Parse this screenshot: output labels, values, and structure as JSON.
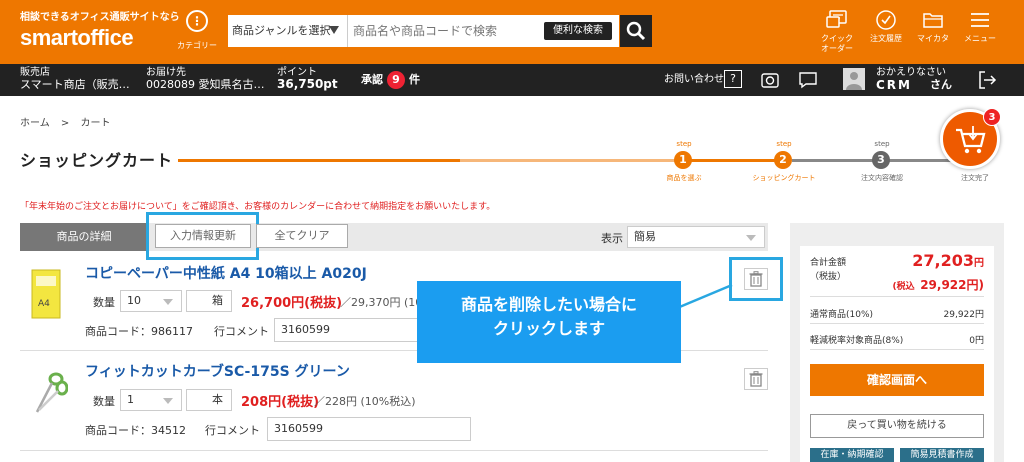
{
  "header": {
    "tagline": "相談できるオフィス通販サイトなら",
    "logo": "smartoffice",
    "category_label": "カテゴリー",
    "search": {
      "genre": "商品ジャンルを選択",
      "placeholder": "商品名や商品コードで検索",
      "advanced": "便利な検索"
    },
    "icons": [
      {
        "icon": "card-icon",
        "label_line1": "クイック",
        "label_line2": "オーダー"
      },
      {
        "icon": "history-icon",
        "label_line1": "注文履歴",
        "label_line2": ""
      },
      {
        "icon": "folder-icon",
        "label_line1": "マイカタ",
        "label_line2": ""
      },
      {
        "icon": "menu-icon",
        "label_line1": "メニュー",
        "label_line2": ""
      }
    ]
  },
  "infobar": {
    "store_label": "販売店",
    "store_value": "スマート商店（販売…",
    "ship_label": "お届け先",
    "ship_value": "0028089 愛知県名古…",
    "points_label": "ポイント",
    "points_value": "36,750pt",
    "approval_label": "承認",
    "approval_count": "9",
    "approval_suffix": "件",
    "contact": "お問い合わせ",
    "contact_icon": "?",
    "greeting": "おかえりなさい",
    "user_name": "CRM",
    "user_suffix": "さん"
  },
  "breadcrumb": {
    "home": "ホーム",
    "sep": ">",
    "current": "カート"
  },
  "page_title": "ショッピングカート",
  "steps": [
    {
      "word": "step",
      "num": "1",
      "label": "商品を選ぶ"
    },
    {
      "word": "step",
      "num": "2",
      "label": "ショッピングカート"
    },
    {
      "word": "step",
      "num": "3",
      "label": "注文内容確認"
    },
    {
      "word": "",
      "num": "",
      "label": "注文完了"
    }
  ],
  "cart_badge": "3",
  "notice": "「年末年始のご注文とお届けについて」をご確認頂き、お客様のカレンダーに合わせて納期指定をお願いいたします。",
  "toolbar": {
    "tab": "商品の詳細",
    "update": "入力情報更新",
    "clear": "全てクリア",
    "display_label": "表示",
    "display_value": "簡易"
  },
  "items": [
    {
      "name": "コピーペーパー中性紙 A4 10箱以上 A020J",
      "qty_label": "数量",
      "qty": "10",
      "unit": "箱",
      "price": "26,700円(税抜)",
      "price_sub": "／29,370円 (10",
      "code": "商品コード：986117",
      "comment_label": "行コメント",
      "comment": "3160599"
    },
    {
      "name": "フィットカットカーブSC-175S グリーン",
      "qty_label": "数量",
      "qty": "1",
      "unit": "本",
      "price": "208円(税抜)",
      "price_sub": "／228円 (10%税込)",
      "code": "商品コード：34512",
      "comment_label": "行コメント",
      "comment": "3160599"
    }
  ],
  "callout": {
    "line1": "商品を削除したい場合に",
    "line2": "クリックします"
  },
  "summary": {
    "total_label1": "合計金額",
    "total_label2": "（税抜）",
    "total": "27,203",
    "total_unit": "円",
    "taxin_prefix": "(税込",
    "taxin": "29,922円)",
    "normal_label": "通常商品(10%)",
    "normal_value": "29,922円",
    "reduced_label": "軽減税率対象商品(8%)",
    "reduced_value": "0円",
    "confirm": "確認画面へ",
    "continue": "戻って買い物を続ける",
    "stock": "在庫・納期確認",
    "quote": "簡易見積書作成"
  },
  "colors": {
    "brand_orange": "#ee7700",
    "price_red": "#e02020",
    "highlight_blue": "#29a7e1",
    "callout_blue": "#1b9df0"
  }
}
